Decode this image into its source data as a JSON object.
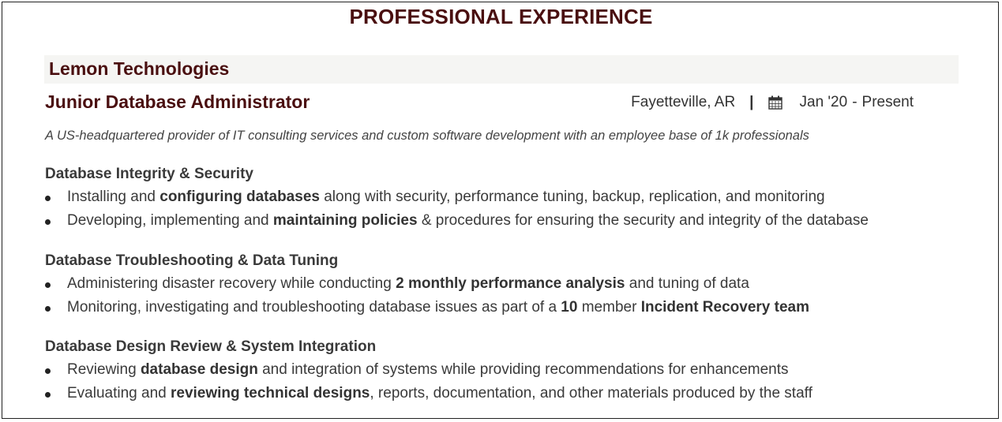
{
  "section_title": "PROFESSIONAL EXPERIENCE",
  "company": "Lemon Technologies",
  "job_title": "Junior Database Administrator",
  "location": "Fayetteville, AR",
  "separator": "|",
  "calendar_icon": "calendar-icon",
  "date_start": "Jan '20",
  "date_dash": "-",
  "date_end": "Present",
  "description": "A US-headquartered provider of IT consulting services and custom software development with an employee base of 1k professionals",
  "groups": [
    {
      "title": "Database Integrity & Security",
      "items": [
        [
          {
            "t": "Installing and ",
            "b": false
          },
          {
            "t": "configuring databases",
            "b": true
          },
          {
            "t": " along with security, performance tuning, backup, replication, and monitoring",
            "b": false
          }
        ],
        [
          {
            "t": "Developing, implementing and ",
            "b": false
          },
          {
            "t": "maintaining policies",
            "b": true
          },
          {
            "t": " & procedures for ensuring the security and integrity of the database",
            "b": false
          }
        ]
      ]
    },
    {
      "title": "Database Troubleshooting & Data Tuning",
      "items": [
        [
          {
            "t": "Administering disaster recovery while conducting ",
            "b": false
          },
          {
            "t": "2 monthly performance analysis",
            "b": true
          },
          {
            "t": " and tuning of data",
            "b": false
          }
        ],
        [
          {
            "t": "Monitoring, investigating and troubleshooting database issues as part of a ",
            "b": false
          },
          {
            "t": "10",
            "b": true
          },
          {
            "t": " member ",
            "b": false
          },
          {
            "t": "Incident Recovery team",
            "b": true
          }
        ]
      ]
    },
    {
      "title": "Database Design Review & System Integration",
      "items": [
        [
          {
            "t": "Reviewing ",
            "b": false
          },
          {
            "t": "database design",
            "b": true
          },
          {
            "t": " and integration of systems while providing recommendations for enhancements",
            "b": false
          }
        ],
        [
          {
            "t": "Evaluating and ",
            "b": false
          },
          {
            "t": "reviewing technical designs",
            "b": true
          },
          {
            "t": ", reports, documentation, and other materials produced by the staff",
            "b": false
          }
        ]
      ]
    }
  ]
}
